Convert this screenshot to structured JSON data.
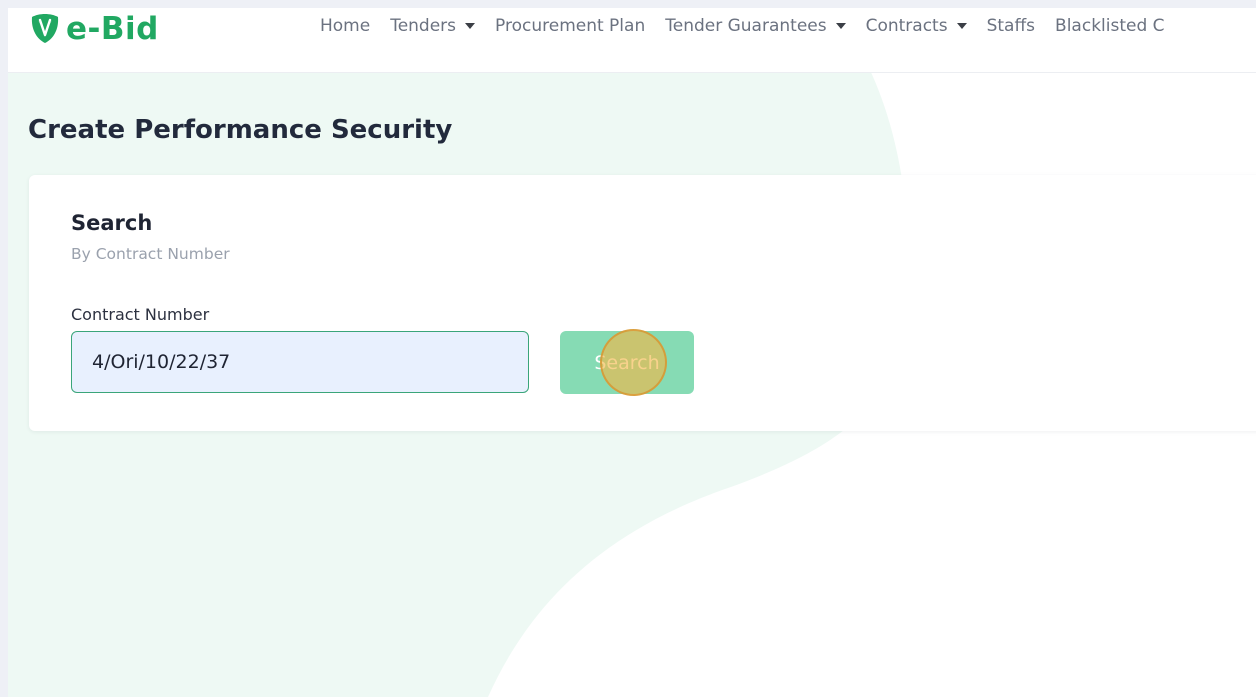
{
  "brand": {
    "name": "e-Bid",
    "color": "#21a862",
    "logo_icon": "shield-leaf-icon"
  },
  "nav": {
    "items": [
      {
        "label": "Home",
        "dropdown": false
      },
      {
        "label": "Tenders",
        "dropdown": true
      },
      {
        "label": "Procurement Plan",
        "dropdown": false
      },
      {
        "label": "Tender Guarantees",
        "dropdown": true
      },
      {
        "label": "Contracts",
        "dropdown": true
      },
      {
        "label": "Staffs",
        "dropdown": false
      },
      {
        "label": "Blacklisted C",
        "dropdown": false
      }
    ]
  },
  "page": {
    "title": "Create Performance Security"
  },
  "search_card": {
    "title": "Search",
    "subtitle": "By Contract Number",
    "field_label": "Contract Number",
    "contract_number_value": "4/Ori/10/22/37",
    "button_label": "Search"
  },
  "colors": {
    "accent": "#21a862",
    "button_bg": "#86dbb4",
    "input_bg": "#e8f0fe",
    "input_border": "#3aa57a",
    "blob": "#eef9f4",
    "click_marker": "#f4b646"
  }
}
